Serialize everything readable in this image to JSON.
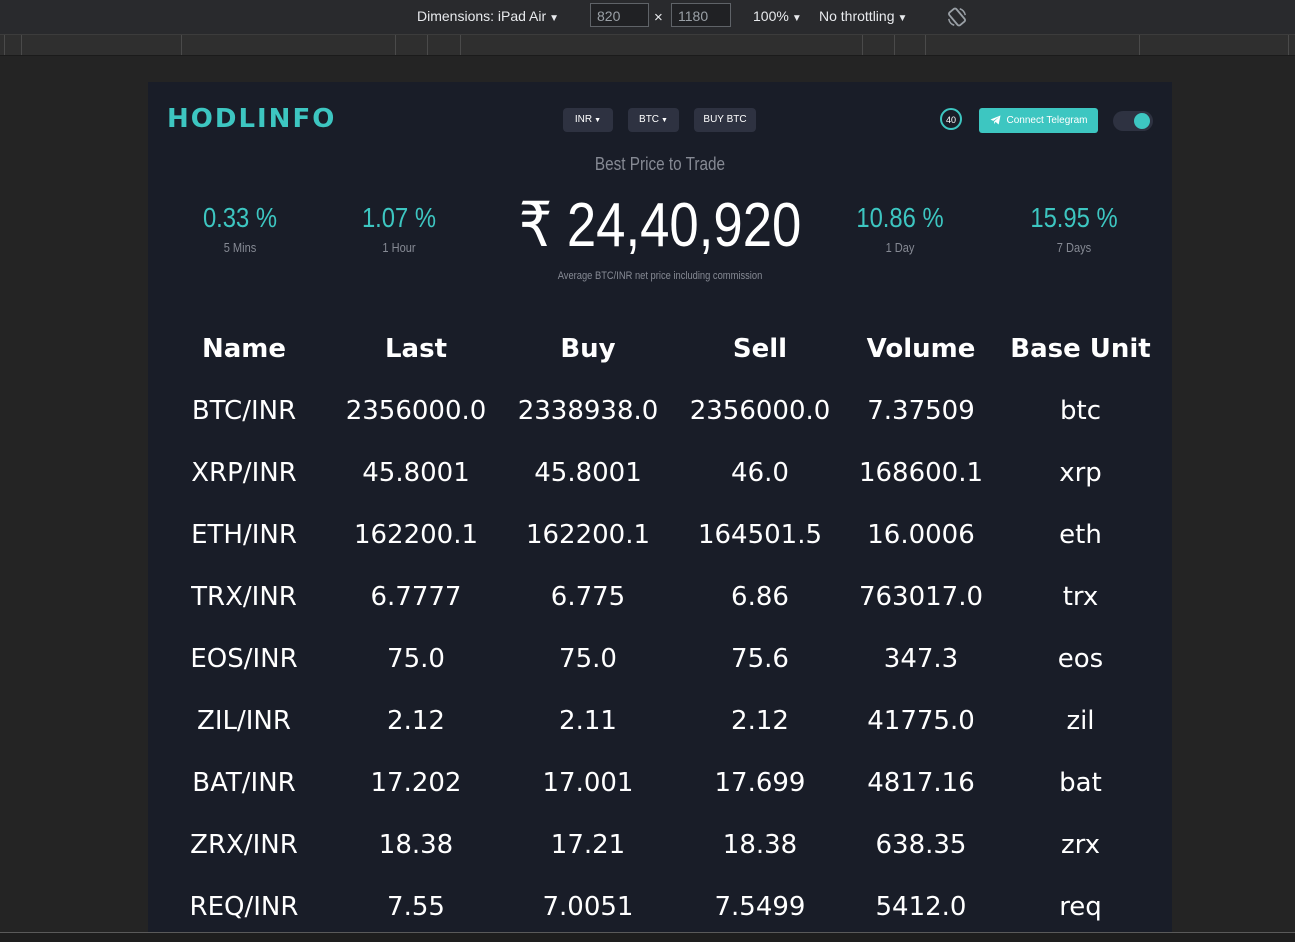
{
  "devtools": {
    "dimensions_label": "Dimensions: iPad Air",
    "width": "820",
    "height": "1180",
    "times": "×",
    "zoom": "100%",
    "throttling": "No throttling"
  },
  "site": {
    "logo": "HODLINFO",
    "currency_btn": "INR",
    "asset_btn": "BTC",
    "buy_btn": "BUY BTC",
    "timer": "40",
    "telegram_btn": "Connect Telegram",
    "subtitle": "Best Price to Trade",
    "price": "₹ 24,40,920",
    "price_note": "Average BTC/INR net price including commission",
    "stats": [
      {
        "value": "0.33 %",
        "label": "5 Mins"
      },
      {
        "value": "1.07 %",
        "label": "1 Hour"
      },
      {
        "value": "10.86 %",
        "label": "1 Day"
      },
      {
        "value": "15.95 %",
        "label": "7 Days"
      }
    ],
    "accent_color": "#3dc6c1",
    "toggle_on": true
  },
  "table": {
    "headers": [
      "Name",
      "Last",
      "Buy",
      "Sell",
      "Volume",
      "Base Unit"
    ],
    "rows": [
      [
        "BTC/INR",
        "2356000.0",
        "2338938.0",
        "2356000.0",
        "7.37509",
        "btc"
      ],
      [
        "XRP/INR",
        "45.8001",
        "45.8001",
        "46.0",
        "168600.1",
        "xrp"
      ],
      [
        "ETH/INR",
        "162200.1",
        "162200.1",
        "164501.5",
        "16.0006",
        "eth"
      ],
      [
        "TRX/INR",
        "6.7777",
        "6.775",
        "6.86",
        "763017.0",
        "trx"
      ],
      [
        "EOS/INR",
        "75.0",
        "75.0",
        "75.6",
        "347.3",
        "eos"
      ],
      [
        "ZIL/INR",
        "2.12",
        "2.11",
        "2.12",
        "41775.0",
        "zil"
      ],
      [
        "BAT/INR",
        "17.202",
        "17.001",
        "17.699",
        "4817.16",
        "bat"
      ],
      [
        "ZRX/INR",
        "18.38",
        "17.21",
        "18.38",
        "638.35",
        "zrx"
      ],
      [
        "REQ/INR",
        "7.55",
        "7.0051",
        "7.5499",
        "5412.0",
        "req"
      ]
    ]
  }
}
